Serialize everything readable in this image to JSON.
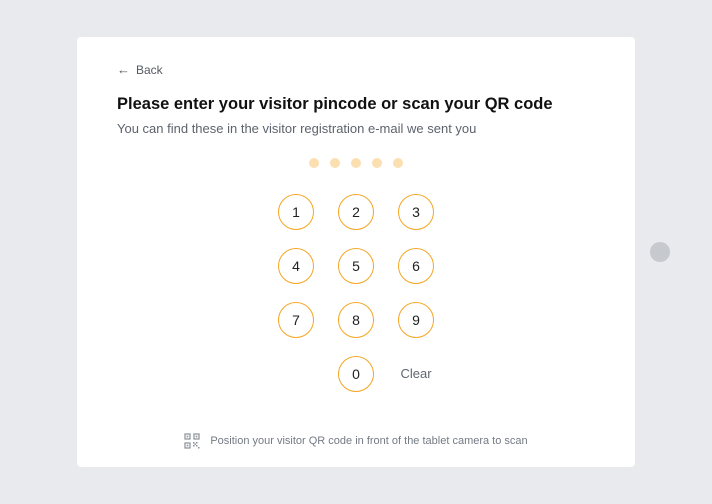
{
  "back": {
    "label": "Back"
  },
  "title": "Please enter your visitor pincode or scan your QR code",
  "subtitle": "You can find these in the visitor registration e-mail we sent you",
  "pin_length": 5,
  "keypad": {
    "k1": "1",
    "k2": "2",
    "k3": "3",
    "k4": "4",
    "k5": "5",
    "k6": "6",
    "k7": "7",
    "k8": "8",
    "k9": "9",
    "k0": "0",
    "clear": "Clear"
  },
  "footer": {
    "text": "Position your visitor QR code in front of the tablet camera to scan"
  },
  "colors": {
    "accent": "#F5A623",
    "dot": "#fcdfb1"
  }
}
